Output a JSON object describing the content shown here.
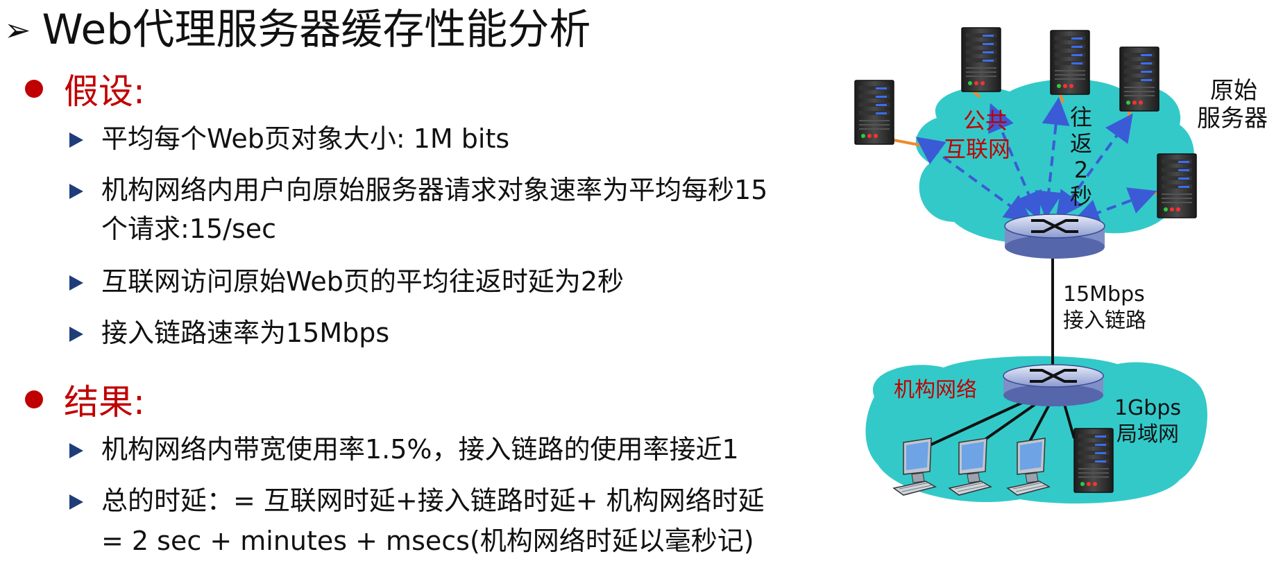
{
  "title": {
    "marker": "➢",
    "text": "Web代理服务器缓存性能分析"
  },
  "assumptions": {
    "heading": "假设:",
    "items": [
      "平均每个Web页对象大小: 1M bits",
      "机构网络内用户向原始服务器请求对象速率为平均每秒15",
      "个请求:15/sec",
      "互联网访问原始Web页的平均往返时延为2秒",
      "接入链路速率为15Mbps"
    ]
  },
  "results": {
    "heading": "结果:",
    "items": [
      "机构网络内带宽使用率1.5%，接入链路的使用率接近1",
      "总的时延：= 互联网时延+接入链路时延+ 机构网络时延",
      "=  2 sec + minutes + msecs(机构网络时延以毫秒记)"
    ]
  },
  "diagram": {
    "public_internet_line1": "公共",
    "public_internet_line2": "互联网",
    "rtt_chars": [
      "往",
      "返",
      "2",
      "秒"
    ],
    "origin_servers_line1": "原始",
    "origin_servers_line2": "服务器",
    "access_link_line1": "15Mbps",
    "access_link_line2": "接入链路",
    "institutional_network": "机构网络",
    "lan_line1": "1Gbps",
    "lan_line2": "局域网"
  },
  "colors": {
    "heading_red": "#c00000",
    "cloud": "#33c9c9",
    "arrow_blue": "#3b5bd6",
    "bullet_navy": "#1f3d7a"
  }
}
